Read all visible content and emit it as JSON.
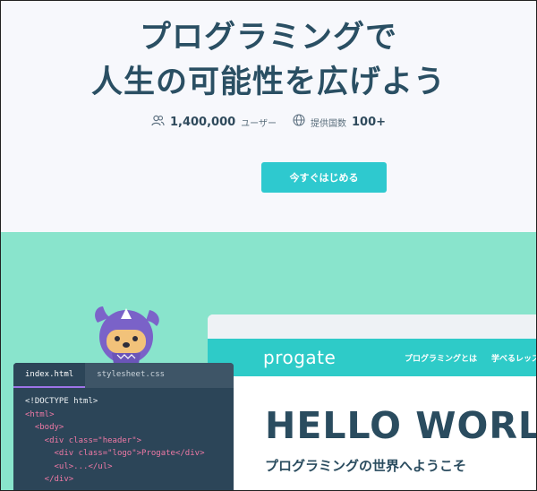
{
  "hero": {
    "headline_line1": "プログラミングで",
    "headline_line2": "人生の可能性を広げよう",
    "stats": {
      "users_count": "1,400,000",
      "users_unit": "ユーザー",
      "countries_label": "提供国数",
      "countries_count": "100+"
    },
    "cta_label": "今すぐはじめる"
  },
  "browser_mock": {
    "brand": "progate",
    "nav_items": [
      "プログラミングとは",
      "学べるレッスン"
    ],
    "headline": "HELLO WORLD",
    "subheadline": "プログラミングの世界へようこそ"
  },
  "editor": {
    "tabs": [
      "index.html",
      "stylesheet.css"
    ],
    "active_tab": "index.html",
    "code_lines": [
      "<!DOCTYPE html>",
      "<html>",
      "  <body>",
      "    <div class=\"header\">",
      "      <div class=\"logo\">Progate</div>",
      "      <ul>...</ul>",
      "    </div>"
    ]
  },
  "colors": {
    "accent": "#2ec9cf",
    "green_band": "#89e4cc",
    "text_dark": "#2a4f63",
    "editor_bg": "#2c4558"
  },
  "icons": {
    "users": "users-icon",
    "globe": "globe-icon",
    "mascot": "ninja-mascot"
  }
}
